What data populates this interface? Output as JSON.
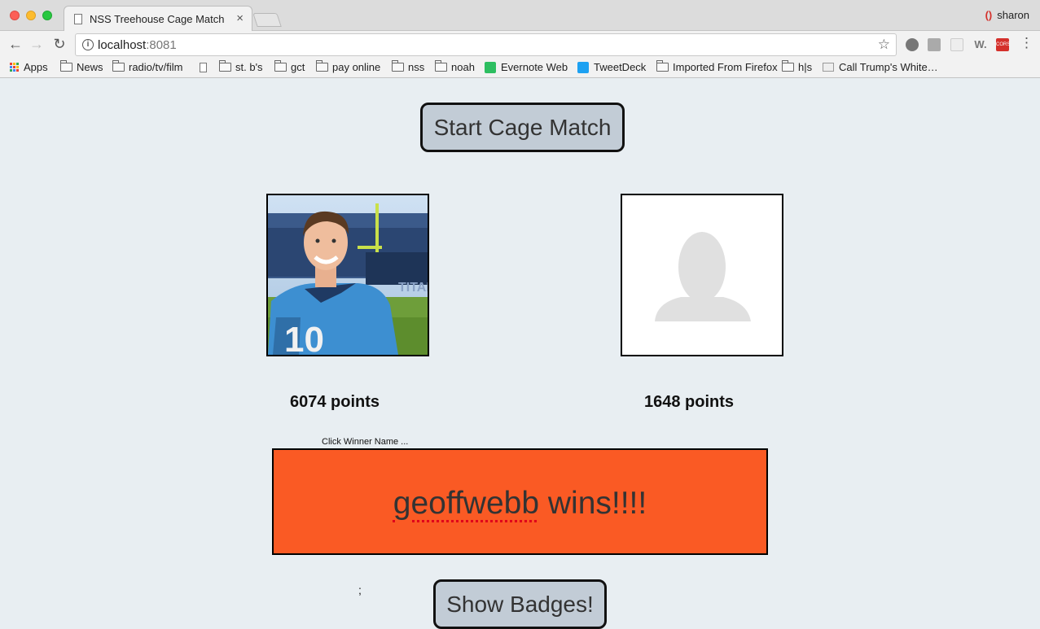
{
  "browser": {
    "tab_title": "NSS Treehouse Cage Match",
    "tab_close": "×",
    "profile_name": "sharon",
    "url_host": "localhost",
    "url_port": ":8081",
    "bookmarks": [
      {
        "label": "Apps",
        "icon": "apps-icon"
      },
      {
        "label": "News",
        "icon": "folder-icon"
      },
      {
        "label": "radio/tv/film",
        "icon": "folder-icon"
      },
      {
        "label": "",
        "icon": "page-icon"
      },
      {
        "label": "st. b's",
        "icon": "folder-icon"
      },
      {
        "label": "gct",
        "icon": "folder-icon"
      },
      {
        "label": "pay online",
        "icon": "folder-icon"
      },
      {
        "label": "nss",
        "icon": "folder-icon"
      },
      {
        "label": "noah",
        "icon": "folder-icon"
      },
      {
        "label": "Evernote Web",
        "icon": "evernote-icon"
      },
      {
        "label": "TweetDeck",
        "icon": "tweetdeck-icon"
      },
      {
        "label": "Imported From Firefox",
        "icon": "folder-icon"
      },
      {
        "label": "h|s",
        "icon": "folder-icon"
      },
      {
        "label": "Call Trump's White…",
        "icon": "whitehouse-icon"
      }
    ],
    "extension_labels": {
      "w": "W.",
      "cors": "CORS"
    }
  },
  "page": {
    "start_button": "Start Cage Match",
    "player1": {
      "points": "6074 points"
    },
    "player2": {
      "points": "1648 points"
    },
    "hint": "Click Winner Name ...",
    "winner_name": "geoffwebb",
    "winner_suffix": " wins!!!!",
    "stray_text": ";",
    "badges_button": "Show Badges!"
  },
  "colors": {
    "page_background": "#e8eef2",
    "winner_background": "#fa5a24",
    "button_background": "#c2ccd6"
  }
}
